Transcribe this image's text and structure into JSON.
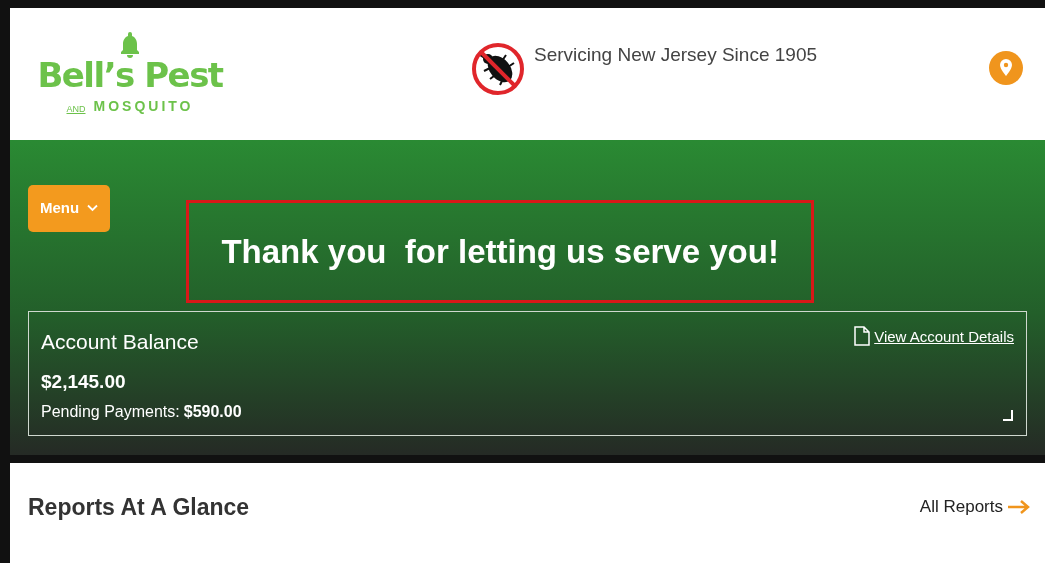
{
  "logo": {
    "name": "Bell’s Pest",
    "conjunction": "AND",
    "subtitle": "MOSQUITO"
  },
  "tagline": "Servicing New Jersey Since 1905",
  "menu_button": {
    "label": "Menu"
  },
  "headline": "Thank you  for letting us serve you!",
  "account": {
    "title": "Account Balance",
    "balance": "$2,145.00",
    "pending_label": "Pending Payments:",
    "pending_amount": "$590.00",
    "link": "View Account Details"
  },
  "reports": {
    "title": "Reports At A Glance",
    "link": "All Reports"
  }
}
